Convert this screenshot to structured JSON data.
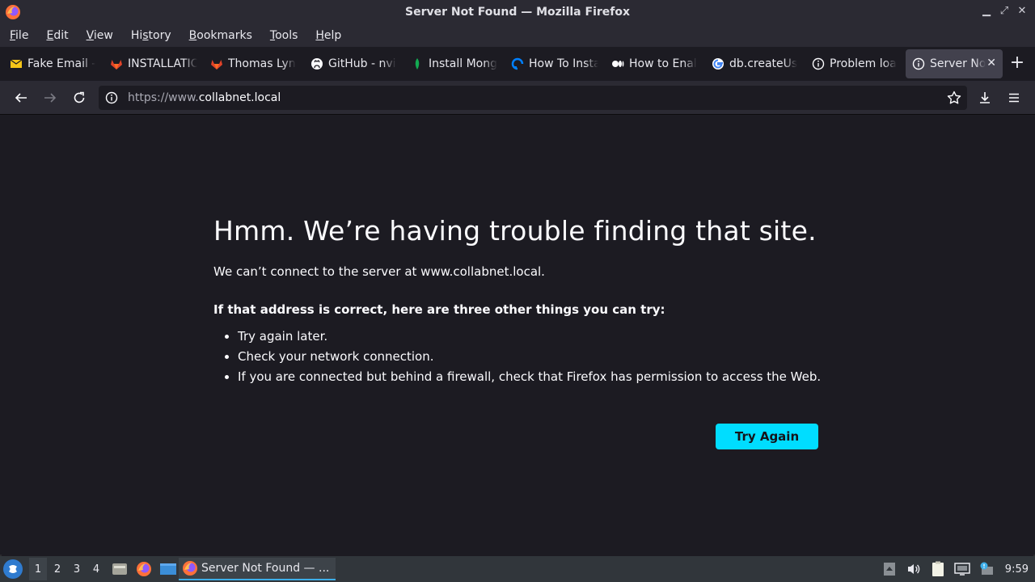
{
  "window": {
    "title": "Server Not Found — Mozilla Firefox"
  },
  "menubar": {
    "items": [
      {
        "pre": "",
        "key": "F",
        "post": "ile"
      },
      {
        "pre": "",
        "key": "E",
        "post": "dit"
      },
      {
        "pre": "",
        "key": "V",
        "post": "iew"
      },
      {
        "pre": "Hi",
        "key": "s",
        "post": "tory"
      },
      {
        "pre": "",
        "key": "B",
        "post": "ookmarks"
      },
      {
        "pre": "",
        "key": "T",
        "post": "ools"
      },
      {
        "pre": "",
        "key": "H",
        "post": "elp"
      }
    ]
  },
  "tabs": [
    {
      "label": "Fake Email -",
      "icon": "mail-icon"
    },
    {
      "label": "INSTALLATIC",
      "icon": "gitlab-icon"
    },
    {
      "label": "Thomas Lyn",
      "icon": "gitlab-icon"
    },
    {
      "label": "GitHub - nvi",
      "icon": "github-icon"
    },
    {
      "label": "Install Mong",
      "icon": "mongodb-icon"
    },
    {
      "label": "How To Insta",
      "icon": "digitalocean-icon"
    },
    {
      "label": "How to Enal",
      "icon": "medium-icon"
    },
    {
      "label": "db.createUs",
      "icon": "google-icon"
    },
    {
      "label": "Problem loa",
      "icon": "info-icon"
    },
    {
      "label": "Server No",
      "icon": "info-icon",
      "active": true
    }
  ],
  "navbar": {
    "url_prefix": "https://www.",
    "url_domain": "collabnet.local"
  },
  "error": {
    "title": "Hmm. We’re having trouble finding that site.",
    "description": "We can’t connect to the server at www.collabnet.local.",
    "tries_title": "If that address is correct, here are three other things you can try:",
    "tries": [
      "Try again later.",
      "Check your network connection.",
      "If you are connected but behind a firewall, check that Firefox has permission to access the Web."
    ],
    "button": "Try Again"
  },
  "taskbar": {
    "workspaces": [
      "1",
      "2",
      "3",
      "4"
    ],
    "window_label": "Server Not Found — ...",
    "clock": "9:59"
  },
  "colors": {
    "accent": "#00ddff",
    "background": "#1c1b22",
    "toolbar": "#2b2a33",
    "taskbar": "#31363b"
  }
}
